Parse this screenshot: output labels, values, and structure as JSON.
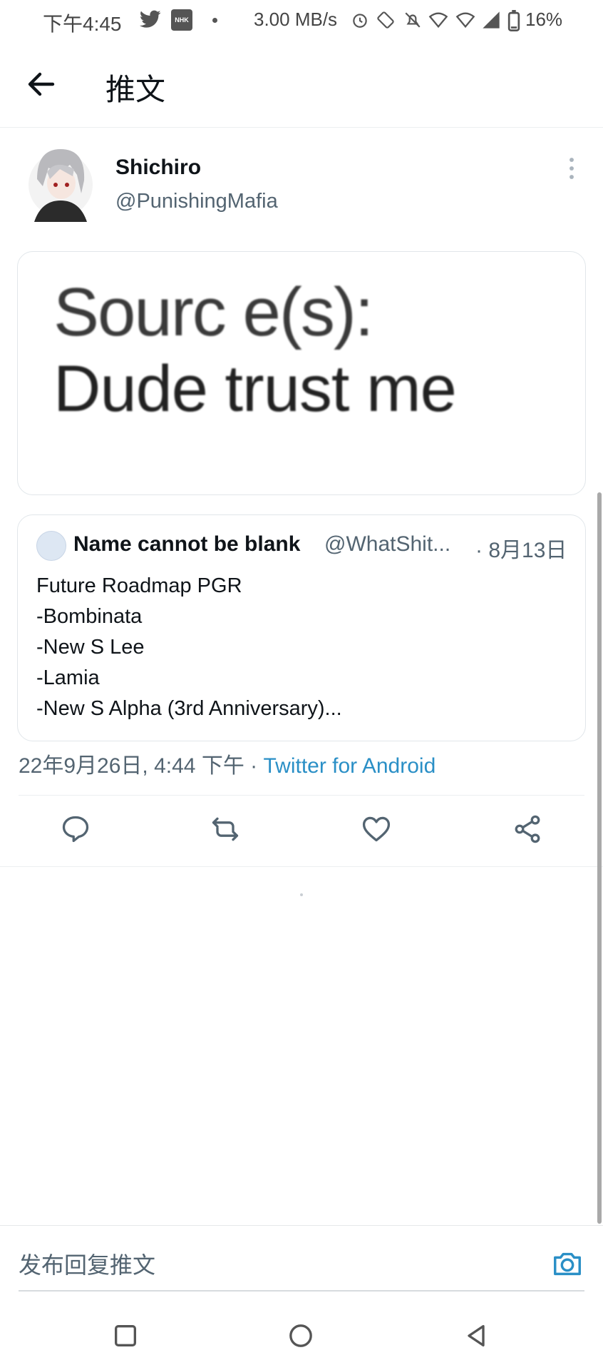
{
  "status_bar": {
    "time": "下午4:45",
    "network_speed": "3.00 MB/s",
    "battery": "16%"
  },
  "header": {
    "title": "推文"
  },
  "tweet": {
    "author_name": "Shichiro",
    "author_handle": "@PunishingMafia",
    "media_text": [
      "Sourc e(s):",
      "Dude trust me"
    ],
    "timestamp": "22年9月26日, 4:44 下午 · ",
    "via": "Twitter for Android"
  },
  "quote_tweet": {
    "author_name": "Name cannot be blank",
    "author_handle": "@WhatShit...",
    "date": "· 8月13日",
    "lines": [
      "Future Roadmap PGR",
      "-Bombinata",
      "-New S Lee",
      "-Lamia",
      "-New S Alpha (3rd Anniversary)..."
    ]
  },
  "actions": [
    "reply-icon",
    "retweet-icon",
    "like-icon",
    "share-icon"
  ],
  "reply": {
    "placeholder": "发布回复推文"
  },
  "colors": {
    "link": "#2a8fc6",
    "muted": "#536471",
    "text": "#0f1419"
  }
}
